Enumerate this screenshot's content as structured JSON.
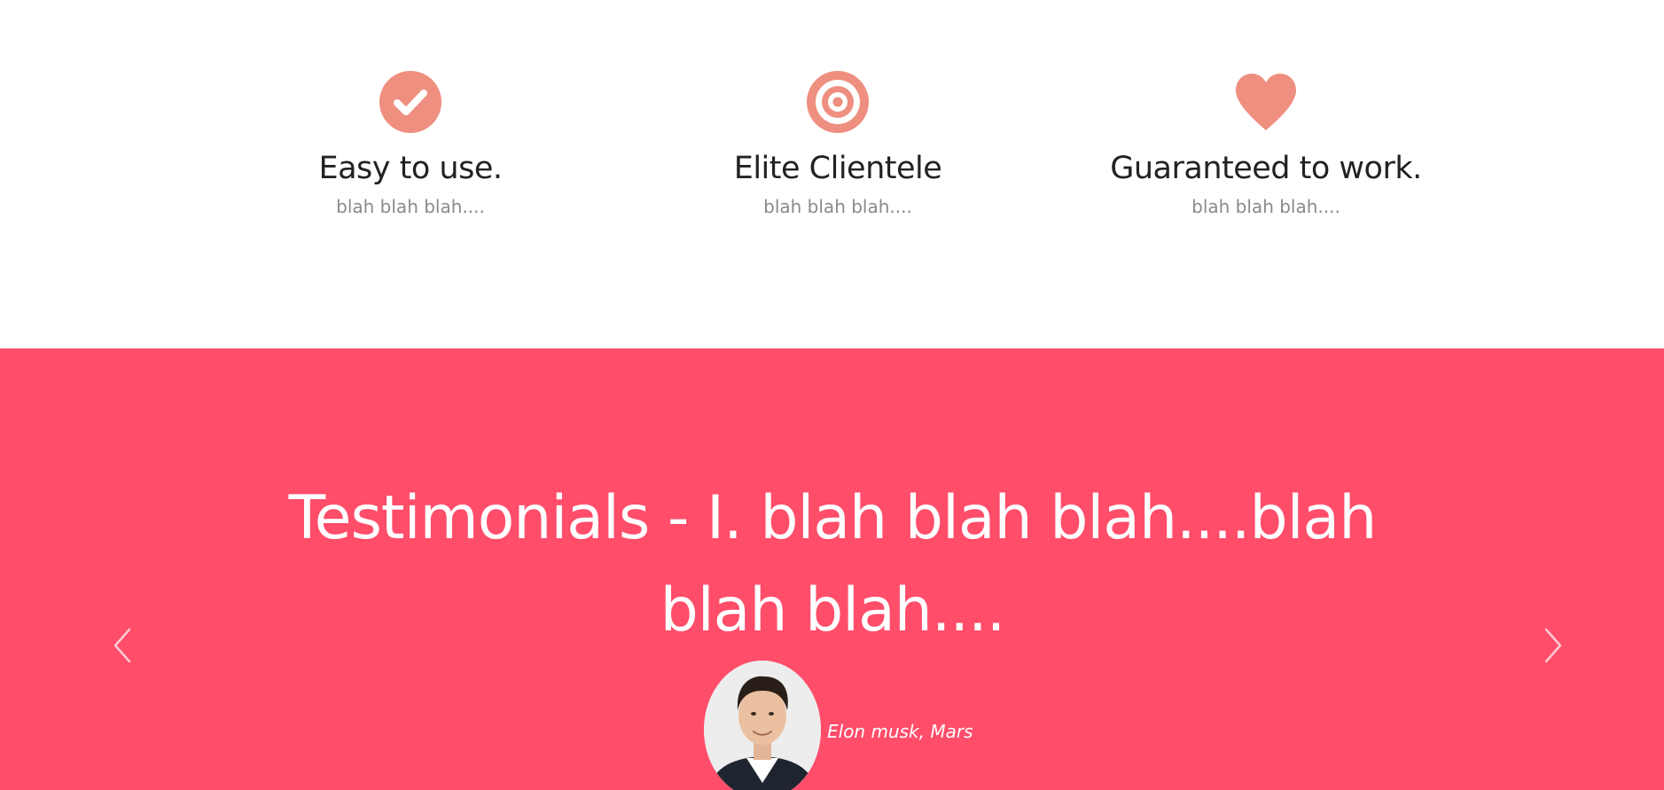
{
  "features": [
    {
      "icon": "check-circle-icon",
      "title": "Easy to use.",
      "desc": "blah blah blah...."
    },
    {
      "icon": "bullseye-icon",
      "title": "Elite Clientele",
      "desc": "blah blah blah...."
    },
    {
      "icon": "heart-icon",
      "title": "Guaranteed to work.",
      "desc": "blah blah blah...."
    }
  ],
  "colors": {
    "icon": "#ef8f80",
    "band": "#ff4d6a",
    "heading": "#222222",
    "muted": "#8a8a8a"
  },
  "testimonials": {
    "quote": "Testimonials - I. blah blah blah....blah blah blah....",
    "author": "Elon musk, Mars",
    "prev_icon": "chevron-left-icon",
    "next_icon": "chevron-right-icon"
  }
}
